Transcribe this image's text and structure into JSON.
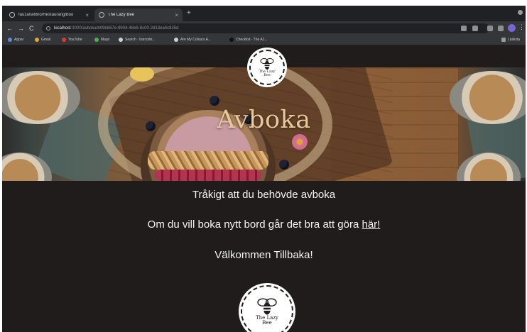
{
  "browser": {
    "tabs": [
      {
        "title": "fauzanafitrio/RestauranglBoo"
      },
      {
        "title": "The Lazy Bee"
      }
    ],
    "new_tab": "+",
    "close": "×",
    "nav": {
      "back": "←",
      "forward": "→",
      "reload": "C"
    },
    "url": {
      "host": "localhost",
      "path": ":3000/avboka/b09b867e-9904-48e9-8c00-2d13ea4c825d"
    },
    "menu": "⋮",
    "bookmarks": [
      {
        "label": "Appar",
        "color": "#5f8bd8"
      },
      {
        "label": "Gmail",
        "color": "#e5a33b"
      },
      {
        "label": "YouTube",
        "color": "#e03a2f"
      },
      {
        "label": "Maps",
        "color": "#4caf50"
      },
      {
        "label": "Search · barcode...",
        "color": "#cfcfcf"
      },
      {
        "label": "Are My Colours A...",
        "color": "#cfcfcf"
      },
      {
        "label": "Checklist - The A1...",
        "color": "#111111"
      }
    ],
    "reading_list": "Läslista"
  },
  "page": {
    "logo_text_line1": "The Lazy",
    "logo_text_line2": "Bee",
    "hero_title": "Avboka",
    "message_line1": "Tråkigt att du behövde avboka",
    "message_line2_prefix": "Om du vill boka nytt bord går det bra att göra ",
    "message_line2_link": "här!",
    "message_line3": "Välkommen Tillbaka!",
    "colors": {
      "background": "#1f1c1b",
      "hero_title": "#e8c99a",
      "text": "#f3f3f3"
    }
  }
}
